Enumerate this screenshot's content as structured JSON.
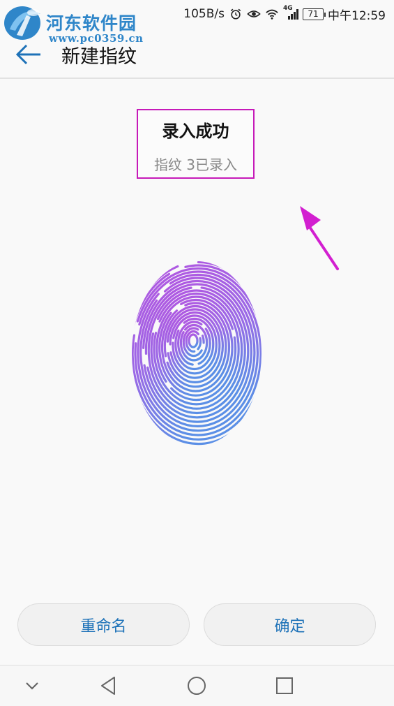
{
  "watermark": {
    "title": "河东软件园",
    "url": "www.pc0359.cn"
  },
  "status_bar": {
    "net_speed": "105B/s",
    "network_type": "4G",
    "battery": "71",
    "time": "中午12:59",
    "icons": [
      "alarm-icon",
      "eye-icon",
      "wifi-icon",
      "signal-icon",
      "battery-icon"
    ]
  },
  "app_bar": {
    "title": "新建指纹",
    "back_icon": "arrow-left-icon"
  },
  "result": {
    "title": "录入成功",
    "subtitle": "指纹 3已录入"
  },
  "actions": {
    "rename_label": "重命名",
    "confirm_label": "确定"
  },
  "nav": {
    "icons": [
      "chevron-down-icon",
      "back-triangle-icon",
      "home-circle-icon",
      "recents-square-icon"
    ]
  },
  "colors": {
    "accent_blue": "#1e72b8",
    "highlight_magenta": "#c61ab9",
    "fingerprint_top": "#b454e0",
    "fingerprint_bottom": "#5b8fe6"
  }
}
